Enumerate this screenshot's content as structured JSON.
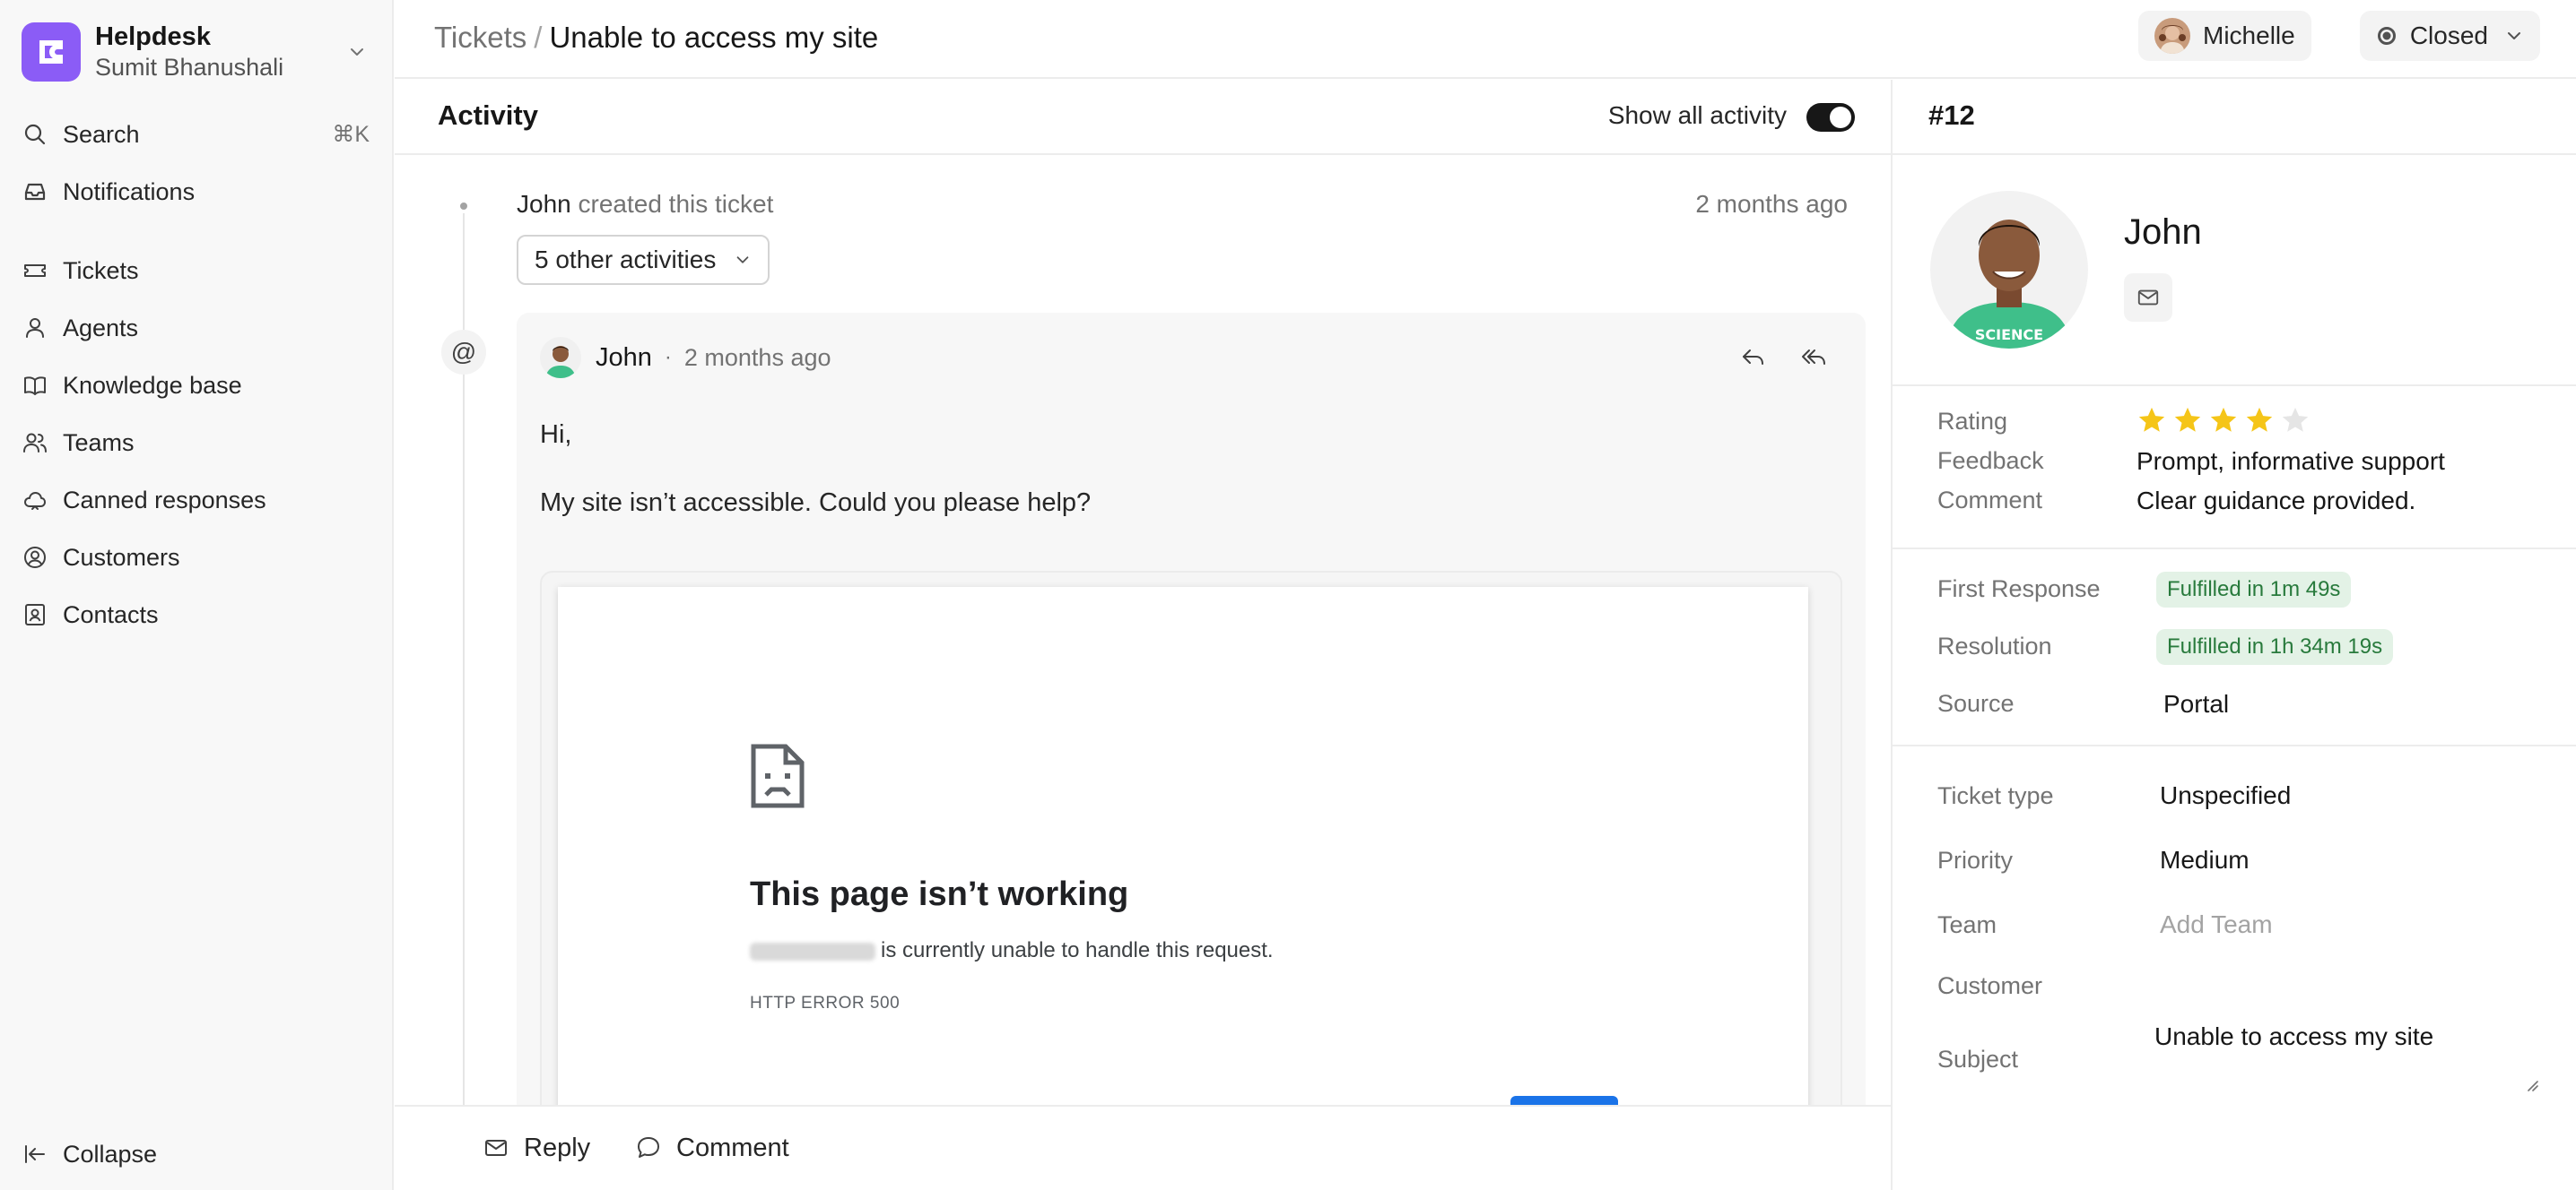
{
  "sidebar": {
    "brand_name": "Helpdesk",
    "brand_user": "Sumit Bhanushali",
    "search_label": "Search",
    "search_shortcut": "⌘K",
    "notifications_label": "Notifications",
    "items": [
      {
        "label": "Tickets",
        "icon": "ticket-icon"
      },
      {
        "label": "Agents",
        "icon": "user-icon"
      },
      {
        "label": "Knowledge base",
        "icon": "book-icon"
      },
      {
        "label": "Teams",
        "icon": "users-icon"
      },
      {
        "label": "Canned responses",
        "icon": "cloud-icon"
      },
      {
        "label": "Customers",
        "icon": "customer-icon"
      },
      {
        "label": "Contacts",
        "icon": "contact-icon"
      }
    ],
    "collapse_label": "Collapse"
  },
  "header": {
    "breadcrumb_root": "Tickets",
    "breadcrumb_separator": "/",
    "breadcrumb_current": "Unable to access my site",
    "assignee": "Michelle",
    "status": "Closed"
  },
  "activity": {
    "title": "Activity",
    "toggle_label": "Show all activity",
    "toggle_on": true,
    "created_by": "John",
    "created_text": "created this ticket",
    "created_time": "2 months ago",
    "other_activities": "5 other activities",
    "email": {
      "author": "John",
      "separator": "·",
      "time": "2 months ago",
      "greeting": "Hi,",
      "message": "My site isn’t accessible. Could you please help?",
      "attachment": {
        "title": "This page isn’t working",
        "description": "is currently unable to handle this request.",
        "error_code": "HTTP ERROR 500"
      }
    },
    "composer": {
      "reply_label": "Reply",
      "comment_label": "Comment"
    }
  },
  "details": {
    "ticket_id": "#12",
    "contact_name": "John",
    "rating_label": "Rating",
    "rating": 4,
    "rating_max": 5,
    "feedback_label": "Feedback",
    "feedback": "Prompt, informative support",
    "comment_label": "Comment",
    "comment": "Clear guidance provided.",
    "first_response_label": "First Response",
    "first_response": "Fulfilled in 1m 49s",
    "resolution_label": "Resolution",
    "resolution": "Fulfilled in 1h 34m 19s",
    "source_label": "Source",
    "source": "Portal",
    "ticket_type_label": "Ticket type",
    "ticket_type": "Unspecified",
    "priority_label": "Priority",
    "priority": "Medium",
    "team_label": "Team",
    "team_placeholder": "Add Team",
    "customer_label": "Customer",
    "customer": "",
    "subject_label": "Subject",
    "subject": "Unable to access my site"
  },
  "colors": {
    "brand": "#8b5cf6",
    "star_filled": "#f5c518",
    "star_empty": "#e5e5e5",
    "badge_bg": "#e3f2e6",
    "badge_text": "#287a3c",
    "error_button": "#1a73e8"
  }
}
